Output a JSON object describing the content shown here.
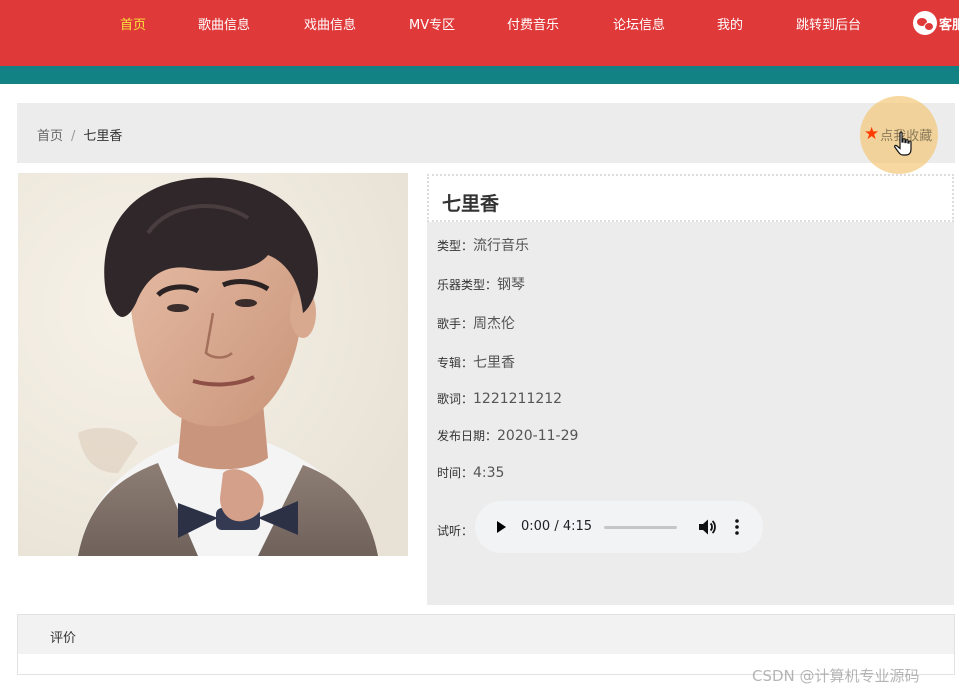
{
  "nav": {
    "items": [
      {
        "label": "首页",
        "active": true
      },
      {
        "label": "歌曲信息",
        "active": false
      },
      {
        "label": "戏曲信息",
        "active": false
      },
      {
        "label": "MV专区",
        "active": false
      },
      {
        "label": "付费音乐",
        "active": false
      },
      {
        "label": "论坛信息",
        "active": false
      },
      {
        "label": "我的",
        "active": false
      },
      {
        "label": "跳转到后台",
        "active": false
      }
    ],
    "kefu_label": "客服",
    "colors": {
      "bar": "#e0393a",
      "band": "#138284",
      "active": "#f7e13b"
    }
  },
  "breadcrumb": {
    "home": "首页",
    "separator": "/",
    "current": "七里香"
  },
  "favorite": {
    "label": "点我收藏",
    "icon": "star-icon"
  },
  "song": {
    "title": "七里香",
    "fields": [
      {
        "label": "类型：",
        "value": "流行音乐"
      },
      {
        "label": "乐器类型：",
        "value": "钢琴"
      },
      {
        "label": "歌手：",
        "value": "周杰伦"
      },
      {
        "label": "专辑：",
        "value": "七里香"
      },
      {
        "label": "歌词：",
        "value": "1221211212"
      },
      {
        "label": "发布日期：",
        "value": "2020-11-29"
      },
      {
        "label": "时间：",
        "value": "4:35"
      }
    ],
    "preview_label": "试听：",
    "audio": {
      "time": "0:00 / 4:15",
      "progress": 0
    }
  },
  "review": {
    "title": "评价"
  },
  "watermark": "CSDN @计算机专业源码"
}
